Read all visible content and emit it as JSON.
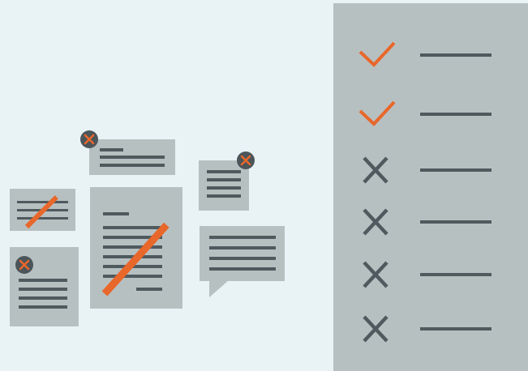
{
  "colors": {
    "background": "#e9f2f5",
    "card": "#b7c0c1",
    "text_line": "#4f5a5f",
    "accent": "#e8672a",
    "badge": "#4b555a"
  },
  "documents": [
    {
      "name": "small-note-card",
      "state": "struck-out"
    },
    {
      "name": "wide-note-card",
      "state": "rejected",
      "icon": "close-icon"
    },
    {
      "name": "narrow-note-card",
      "state": "rejected",
      "icon": "close-icon"
    },
    {
      "name": "large-document-card",
      "state": "struck-out"
    },
    {
      "name": "stacked-note-card",
      "state": "rejected",
      "icon": "close-icon"
    },
    {
      "name": "speech-bubble-card",
      "state": "neutral"
    }
  ],
  "checklist": {
    "items": [
      {
        "status": "checked",
        "icon": "check-icon"
      },
      {
        "status": "checked",
        "icon": "check-icon"
      },
      {
        "status": "unchecked",
        "icon": "x-icon"
      },
      {
        "status": "unchecked",
        "icon": "x-icon"
      },
      {
        "status": "unchecked",
        "icon": "x-icon"
      },
      {
        "status": "unchecked",
        "icon": "x-icon"
      }
    ]
  }
}
